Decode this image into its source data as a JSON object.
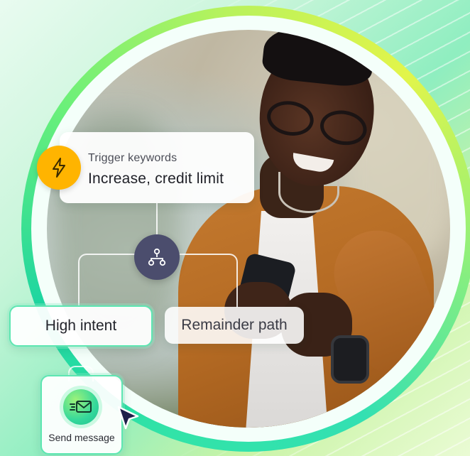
{
  "trigger": {
    "label": "Trigger keywords",
    "value": "Increase, credit limit"
  },
  "branches": {
    "high_intent": "High intent",
    "remainder": "Remainder path"
  },
  "action": {
    "label": "Send message"
  },
  "icons": {
    "trigger": "lightning-bolt-icon",
    "branch": "branch-split-icon",
    "action": "send-mail-icon",
    "pointer": "mouse-cursor-icon"
  },
  "colors": {
    "bolt_badge": "#ffb400",
    "branch_badge": "#4b4d6d",
    "highlight_border": "#5ee6b2",
    "ring_green": "#1fd6a0",
    "ring_lime": "#e2f54a",
    "cursor": "#1f1f4a"
  }
}
